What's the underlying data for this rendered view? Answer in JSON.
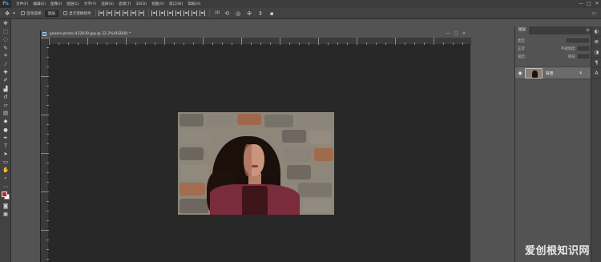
{
  "app": {
    "logo": "Ps"
  },
  "menubar": {
    "items": [
      "文件(F)",
      "编辑(E)",
      "图像(I)",
      "图层(L)",
      "文字(Y)",
      "选择(S)",
      "滤镜(T)",
      "3D(D)",
      "视图(V)",
      "窗口(W)",
      "帮助(H)"
    ],
    "window_controls": [
      "—",
      "□",
      "✕"
    ]
  },
  "options_bar": {
    "auto_select_label": "自动选择:",
    "auto_select_value": "图层",
    "show_transform_label": "显示变换控件"
  },
  "toolbar": {
    "tools": [
      "move-icon",
      "marquee-icon",
      "lasso-icon",
      "quick-select-icon",
      "crop-icon",
      "eyedropper-icon",
      "healing-icon",
      "brush-icon",
      "stamp-icon",
      "history-brush-icon",
      "eraser-icon",
      "gradient-icon",
      "blur-icon",
      "dodge-icon",
      "pen-icon",
      "type-icon",
      "path-select-icon",
      "rectangle-icon",
      "hand-icon",
      "zoom-icon"
    ],
    "colors": {
      "foreground": "#c0272d",
      "background": "#ffffff"
    }
  },
  "document": {
    "title": "pexels-photo-432830.jpg @ 32.2%(RGB/8) *",
    "controls": [
      "—",
      "□",
      "✕"
    ]
  },
  "layers_panel": {
    "tab_label": "图层",
    "kind_label": "类型",
    "mode_label": "正常",
    "opacity_label": "不透明度:",
    "lock_label": "锁定:",
    "fill_label": "填充:",
    "layer": {
      "name": "背景"
    }
  },
  "watermark": "爱创根知识网"
}
